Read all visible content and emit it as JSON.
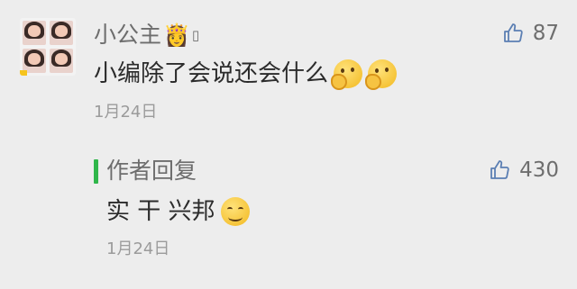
{
  "comment": {
    "username": "小公主",
    "username_icons": [
      "crown-icon",
      "box-icon"
    ],
    "crown_glyph": "👸",
    "box_glyph": "▯",
    "text": "小编除了会说还会什么",
    "emojis": [
      "thinking-emoji-icon",
      "thinking-emoji-icon"
    ],
    "like_count": "87",
    "date": "1月24日"
  },
  "reply": {
    "label": "作者回复",
    "text": "实 干 兴邦",
    "emoji": "smile-emoji-icon",
    "like_count": "430",
    "date": "1月24日",
    "accent_color": "#2fb64a"
  },
  "colors": {
    "background": "#ededed",
    "like_icon": "#5b7fb3"
  }
}
